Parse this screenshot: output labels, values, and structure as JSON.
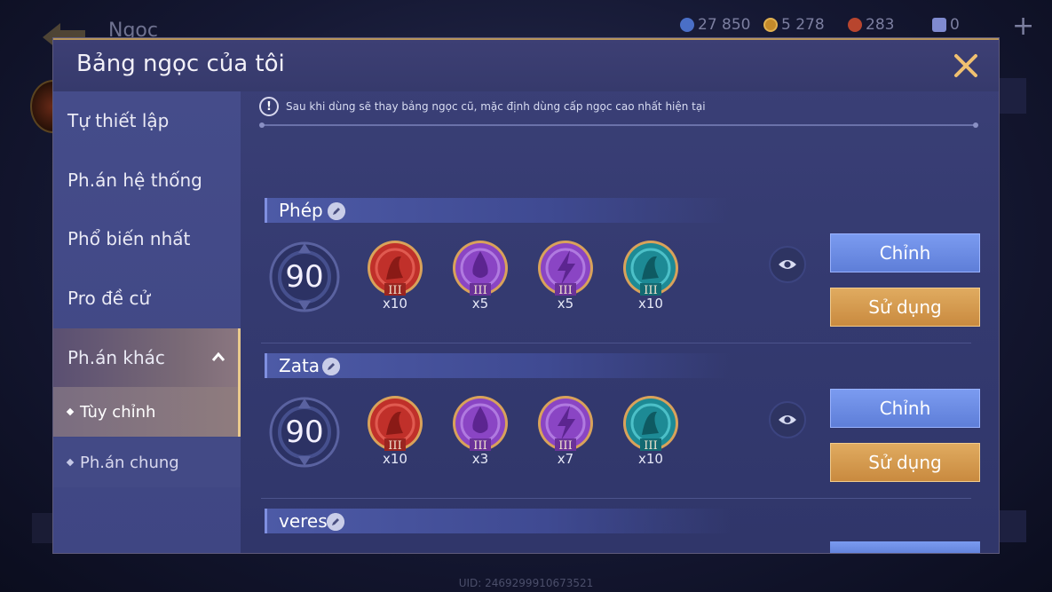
{
  "background": {
    "screen_title": "Ngọc",
    "currencies": [
      {
        "icon": "gem-blue-icon",
        "value": "27 850",
        "color": "#4a6fc7"
      },
      {
        "icon": "coin-gold-icon",
        "value": "5 278",
        "color": "#c48a2a"
      },
      {
        "icon": "ruby-red-icon",
        "value": "283",
        "color": "#b8452e"
      },
      {
        "icon": "voucher-card-icon",
        "value": "0",
        "color": "#7f8ad0"
      }
    ],
    "uid": "UID: 2469299910673521"
  },
  "dialog": {
    "title": "Bảng ngọc của tôi",
    "notice": "Sau khi dùng sẽ thay bảng ngọc cũ, mặc định dùng cấp ngọc cao nhất hiện tại",
    "nav": {
      "items": [
        {
          "label": "Tự thiết lập"
        },
        {
          "label": "Ph.án hệ thống"
        },
        {
          "label": "Phổ biến nhất"
        },
        {
          "label": "Pro đề cử"
        },
        {
          "label": "Ph.án khác",
          "expanded": true
        }
      ],
      "sub_items": [
        {
          "label": "Tùy chỉnh",
          "selected": true
        },
        {
          "label": "Ph.án chung",
          "selected": false
        }
      ]
    },
    "sets": [
      {
        "name": "Phép",
        "level": "90",
        "gems": [
          {
            "type": "red",
            "tier": "III",
            "count": "x10",
            "color": "#c0302a"
          },
          {
            "type": "purple-drop",
            "tier": "III",
            "count": "x5",
            "color": "#8a45c4"
          },
          {
            "type": "purple-bolt",
            "tier": "III",
            "count": "x5",
            "color": "#8a45c4"
          },
          {
            "type": "teal",
            "tier": "III",
            "count": "x10",
            "color": "#1d8a95"
          }
        ],
        "edit_label": "Chỉnh",
        "use_label": "Sử dụng"
      },
      {
        "name": "Zata",
        "level": "90",
        "gems": [
          {
            "type": "red",
            "tier": "III",
            "count": "x10",
            "color": "#c0302a"
          },
          {
            "type": "purple-drop",
            "tier": "III",
            "count": "x3",
            "color": "#8a45c4"
          },
          {
            "type": "purple-bolt",
            "tier": "III",
            "count": "x7",
            "color": "#8a45c4"
          },
          {
            "type": "teal",
            "tier": "III",
            "count": "x10",
            "color": "#1d8a95"
          }
        ],
        "edit_label": "Chỉnh",
        "use_label": "Sử dụng"
      },
      {
        "name": "veres"
      }
    ]
  }
}
